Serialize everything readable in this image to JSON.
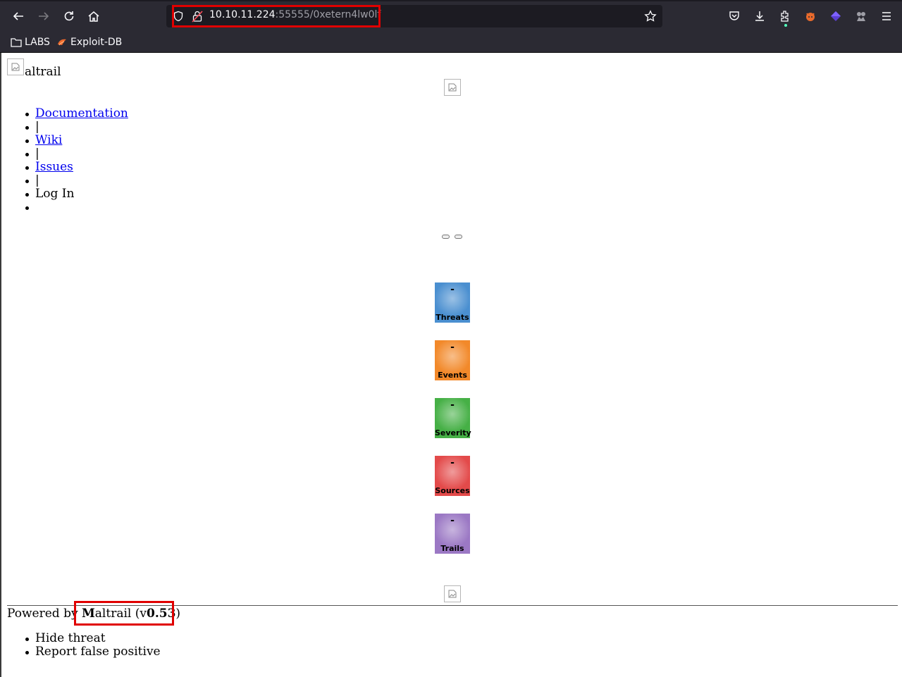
{
  "browser": {
    "url_host": "10.10.11.224",
    "url_path": ":55555/0xetern4lw0lf",
    "bookmarks": [
      {
        "label": "LABS",
        "icon": "folder-icon"
      },
      {
        "label": "Exploit-DB",
        "icon": "exploit-db-icon"
      }
    ],
    "toolbar_icons": [
      "back-icon",
      "forward-icon",
      "reload-icon",
      "home-icon",
      "shield-icon",
      "lock-warning-icon",
      "star-icon",
      "pocket-icon",
      "download-icon",
      "extensions-icon",
      "foxyproxy-icon",
      "extension-cube-icon",
      "extension-puzzle-icon",
      "menu-icon"
    ],
    "accent_color": "#e00000"
  },
  "header": {
    "logo_text": "altrail"
  },
  "nav": {
    "items": [
      "Documentation",
      "|",
      "Wiki",
      "|",
      "Issues",
      "|",
      "Log In",
      ""
    ]
  },
  "stats": [
    {
      "label": "Threats",
      "value": "-",
      "color": "#4a8fd0"
    },
    {
      "label": "Events",
      "value": "-",
      "color": "#f2892a"
    },
    {
      "label": "Severity",
      "value": "-",
      "color": "#46b046"
    },
    {
      "label": "Sources",
      "value": "-",
      "color": "#e34a4a"
    },
    {
      "label": "Trails",
      "value": "-",
      "color": "#9b78c4"
    }
  ],
  "footer": {
    "powered_prefix": "Powered by",
    "brand_initial": "M",
    "brand_rest": "altrail",
    "version_open": "(v",
    "version": "0.53",
    "version_close": ")"
  },
  "context_menu": {
    "items": [
      "Hide threat",
      "Report false positive"
    ]
  }
}
